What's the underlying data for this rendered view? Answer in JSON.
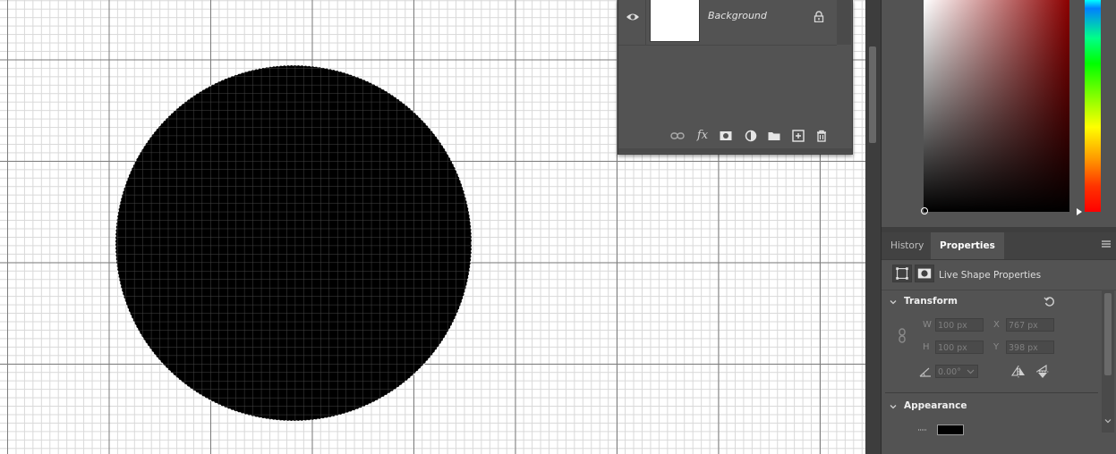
{
  "layers": {
    "layer_name": "Background"
  },
  "dock": {
    "tabs": {
      "history": "History",
      "properties": "Properties"
    },
    "properties": {
      "header": "Live Shape Properties",
      "transform": {
        "title": "Transform",
        "w_label": "W",
        "w_value": "100 px",
        "h_label": "H",
        "h_value": "100 px",
        "x_label": "X",
        "x_value": "767 px",
        "y_label": "Y",
        "y_value": "398 px",
        "angle_value": "0.00°"
      },
      "appearance": {
        "title": "Appearance"
      }
    }
  },
  "colors": {
    "shape_fill": "#000000",
    "ui_panel": "#535353",
    "selected_tab": "#535353"
  },
  "icons": [
    "eye-icon",
    "lock-icon",
    "link-layers-icon",
    "fx-icon",
    "mask-icon",
    "adjustment-icon",
    "folder-icon",
    "new-layer-icon",
    "trash-icon",
    "panel-menu-icon",
    "reset-icon",
    "link-icon",
    "angle-icon",
    "flip-horizontal-icon",
    "flip-vertical-icon",
    "chevron-down-icon"
  ]
}
